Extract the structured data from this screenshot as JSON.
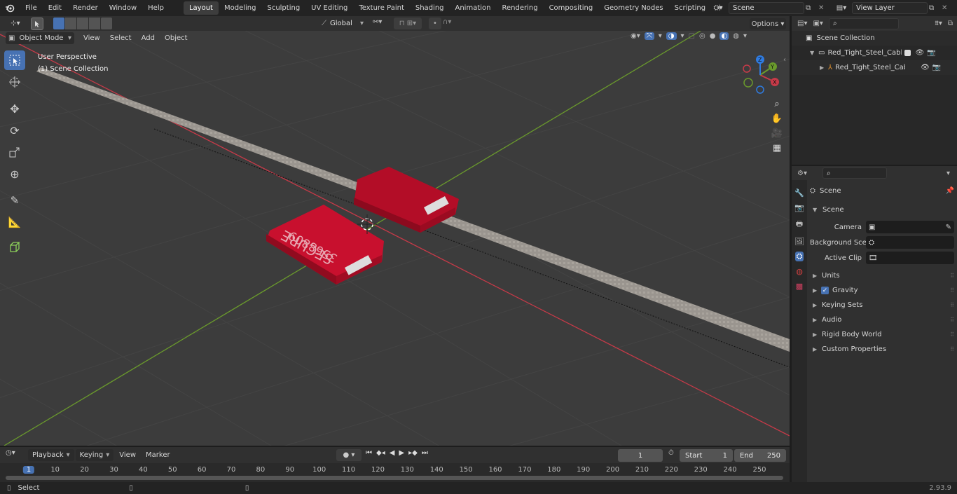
{
  "menu": [
    "File",
    "Edit",
    "Render",
    "Window",
    "Help"
  ],
  "workspaces": [
    "Layout",
    "Modeling",
    "Sculpting",
    "UV Editing",
    "Texture Paint",
    "Shading",
    "Animation",
    "Rendering",
    "Compositing",
    "Geometry Nodes",
    "Scripting"
  ],
  "active_workspace": "Layout",
  "scene_name": "Scene",
  "view_layer": "View Layer",
  "viewport": {
    "mode": "Object Mode",
    "menus": [
      "View",
      "Select",
      "Add",
      "Object"
    ],
    "transform": "Global",
    "options": "Options",
    "overlay_title": "User Perspective",
    "overlay_sub": "(1) Scene Collection",
    "gizmo_axes": [
      "X",
      "Y",
      "Z"
    ],
    "seal_text": "SECURE",
    "seal_number": "3568809"
  },
  "outliner": {
    "root": "Scene Collection",
    "items": [
      "Red_Tight_Steel_Cable_Seal_",
      "Red_Tight_Steel_Cable_S"
    ]
  },
  "properties": {
    "title": "Scene",
    "section": "Scene",
    "fields": [
      {
        "label": "Camera"
      },
      {
        "label": "Background Scene"
      },
      {
        "label": "Active Clip"
      }
    ],
    "panels": [
      "Units",
      "Gravity",
      "Keying Sets",
      "Audio",
      "Rigid Body World",
      "Custom Properties"
    ]
  },
  "timeline": {
    "menus": [
      "Playback",
      "Keying",
      "View",
      "Marker"
    ],
    "current_frame": "1",
    "start_label": "Start",
    "start": "1",
    "end_label": "End",
    "end": "250",
    "ticks": [
      "1",
      "10",
      "20",
      "30",
      "40",
      "50",
      "60",
      "70",
      "80",
      "90",
      "100",
      "110",
      "120",
      "130",
      "140",
      "150",
      "160",
      "170",
      "180",
      "190",
      "200",
      "210",
      "220",
      "230",
      "240",
      "250"
    ]
  },
  "status": {
    "left": "Select",
    "version": "2.93.9"
  },
  "colors": {
    "accent": "#4772b3",
    "x_axis": "#c63a48",
    "y_axis": "#6a9a2c",
    "seal": "#c8102e"
  }
}
